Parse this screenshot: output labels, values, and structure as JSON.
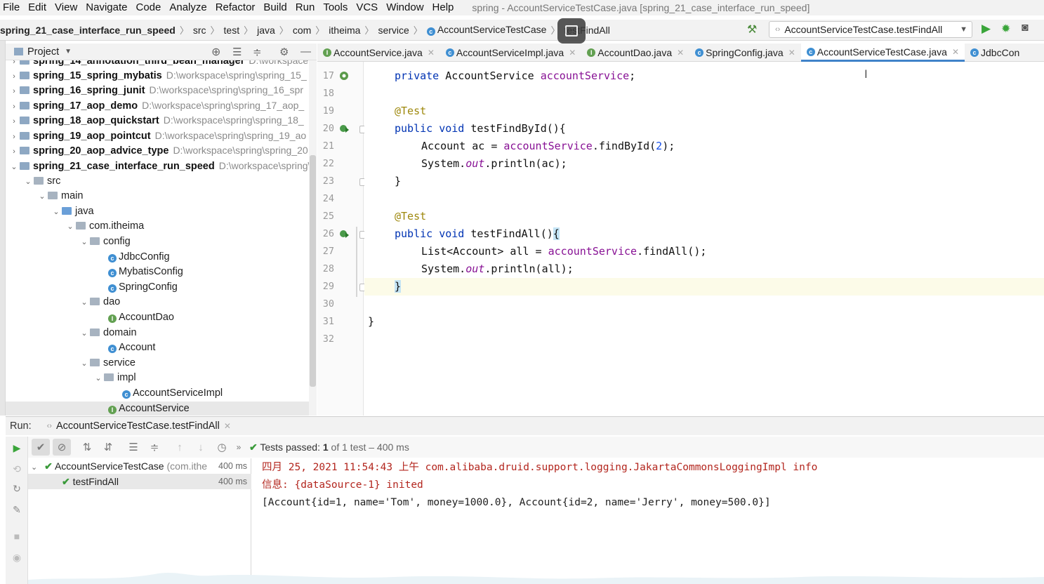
{
  "menu": {
    "items": [
      "File",
      "Edit",
      "View",
      "Navigate",
      "Code",
      "Analyze",
      "Refactor",
      "Build",
      "Run",
      "Tools",
      "VCS",
      "Window",
      "Help"
    ],
    "window_title": "spring - AccountServiceTestCase.java [spring_21_case_interface_run_speed]"
  },
  "breadcrumb": {
    "project": "spring_21_case_interface_run_speed",
    "parts": [
      "src",
      "test",
      "java",
      "com",
      "itheima",
      "service"
    ],
    "class": "AccountServiceTestCase",
    "method": "testFindAll"
  },
  "run_config": {
    "label": "AccountServiceTestCase.testFindAll"
  },
  "project_panel": {
    "title": "Project",
    "tree": [
      {
        "label": "spring_14_annotation_third_bean_manager",
        "path": "D:\\workspace\\",
        "bold": true
      },
      {
        "label": "spring_15_spring_mybatis",
        "path": "D:\\workspace\\spring\\spring_15_",
        "bold": true
      },
      {
        "label": "spring_16_spring_junit",
        "path": "D:\\workspace\\spring\\spring_16_spr",
        "bold": true
      },
      {
        "label": "spring_17_aop_demo",
        "path": "D:\\workspace\\spring\\spring_17_aop_",
        "bold": true
      },
      {
        "label": "spring_18_aop_quickstart",
        "path": "D:\\workspace\\spring\\spring_18_",
        "bold": true
      },
      {
        "label": "spring_19_aop_pointcut",
        "path": "D:\\workspace\\spring\\spring_19_ao",
        "bold": true
      },
      {
        "label": "spring_20_aop_advice_type",
        "path": "D:\\workspace\\spring\\spring_20",
        "bold": true
      },
      {
        "label": "spring_21_case_interface_run_speed",
        "path": "D:\\workspace\\spring\\",
        "bold": true
      },
      {
        "label": "src"
      },
      {
        "label": "main"
      },
      {
        "label": "java"
      },
      {
        "label": "com.itheima"
      },
      {
        "label": "config"
      },
      {
        "label": "JdbcConfig"
      },
      {
        "label": "MybatisConfig"
      },
      {
        "label": "SpringConfig"
      },
      {
        "label": "dao"
      },
      {
        "label": "AccountDao"
      },
      {
        "label": "domain"
      },
      {
        "label": "Account"
      },
      {
        "label": "service"
      },
      {
        "label": "impl"
      },
      {
        "label": "AccountServiceImpl"
      },
      {
        "label": "AccountService"
      }
    ]
  },
  "tabs": [
    {
      "label": "AccountService.java"
    },
    {
      "label": "AccountServiceImpl.java"
    },
    {
      "label": "AccountDao.java"
    },
    {
      "label": "SpringConfig.java"
    },
    {
      "label": "AccountServiceTestCase.java",
      "active": true
    },
    {
      "label": "JdbcCon"
    }
  ],
  "editor": {
    "line_numbers": [
      "17",
      "18",
      "19",
      "20",
      "21",
      "22",
      "23",
      "24",
      "25",
      "26",
      "27",
      "28",
      "29",
      "30",
      "31",
      "32"
    ],
    "lines": {
      "l17_kw": "private ",
      "l17_type": "AccountService ",
      "l17_field": "accountService",
      "l17_end": ";",
      "l19_ann": "@Test",
      "l20_kw": "public void ",
      "l20_name": "testFindById(){",
      "l21_a": "Account ac = ",
      "l21_field": "accountService",
      "l21_b": ".findById(",
      "l21_num": "2",
      "l21_c": ");",
      "l22_a": "System.",
      "l22_out": "out",
      "l22_b": ".println(ac);",
      "l23": "}",
      "l25_ann": "@Test",
      "l26_kw": "public void ",
      "l26_name": "testFindAll()",
      "l26_brace": "{",
      "l27_a": "List<Account> all = ",
      "l27_field": "accountService",
      "l27_b": ".findAll();",
      "l28_a": "System.",
      "l28_out": "out",
      "l28_b": ".println(all);",
      "l29": "}",
      "l31": "}"
    }
  },
  "run_panel": {
    "label": "Run:",
    "tab": "AccountServiceTestCase.testFindAll",
    "status_prefix": "Tests passed: ",
    "status_count": "1",
    "status_suffix": " of 1 test – 400 ms",
    "tests": [
      {
        "name": "AccountServiceTestCase",
        "detail": " (com.ithe",
        "time": "400 ms"
      },
      {
        "name": "testFindAll",
        "time": "400 ms"
      }
    ],
    "console": [
      "四月 25, 2021 11:54:43 上午 com.alibaba.druid.support.logging.JakartaCommonsLoggingImpl info",
      "信息: {dataSource-1} inited",
      "[Account{id=1, name='Tom', money=1000.0}, Account{id=2, name='Jerry', money=500.0}]"
    ]
  },
  "colors": {
    "keyword": "#0033b3",
    "annotation": "#9e880d",
    "field": "#871094",
    "number": "#1750eb",
    "console_red": "#b3261e",
    "pass_green": "#3a9a3a",
    "accent": "#4083c9"
  }
}
